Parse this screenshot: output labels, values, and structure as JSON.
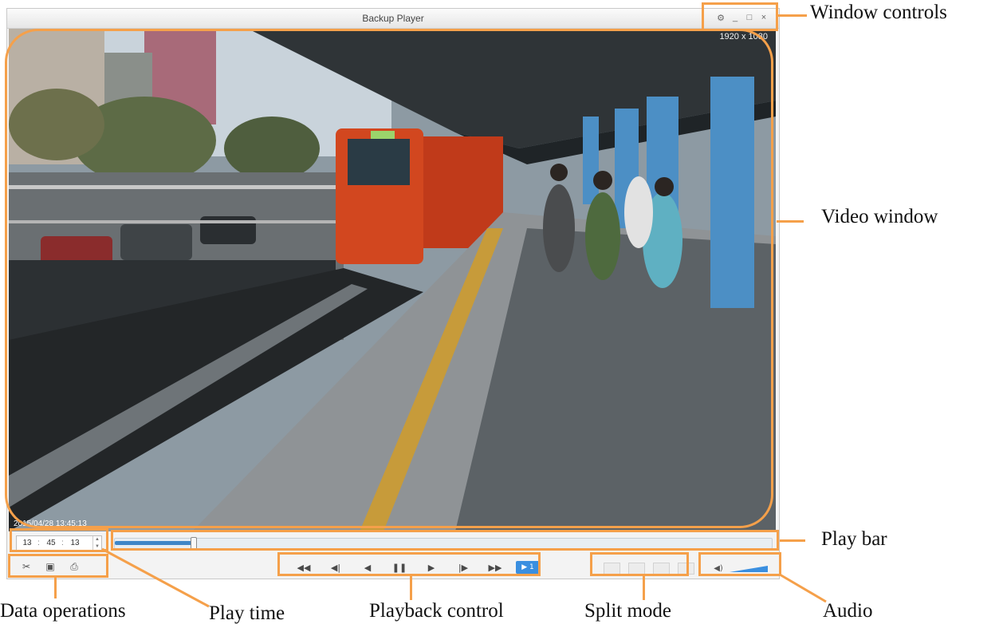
{
  "window": {
    "title": "Backup Player",
    "controls": [
      "⚙",
      "_",
      "□",
      "×"
    ]
  },
  "video": {
    "resolution": "1920 x 1080",
    "osd_timestamp": "2015/04/28 13:45:13"
  },
  "play_time": {
    "hh": "13",
    "mm": "45",
    "ss": "13",
    "sep": ":"
  },
  "play_bar": {
    "progress_percent": 12
  },
  "icons": {
    "data_operations": [
      "clip-icon",
      "snapshot-icon",
      "print-icon"
    ],
    "playback": [
      "fast-backward-icon",
      "step-backward-icon",
      "reverse-play-icon",
      "pause-icon",
      "play-icon",
      "step-forward-icon",
      "fast-forward-icon",
      "speed-icon"
    ],
    "split_modes": [
      "split-1-icon",
      "split-4-icon",
      "split-9-icon",
      "split-16-icon"
    ],
    "audio": [
      "speaker-icon"
    ]
  },
  "glyphs": {
    "data_operations": [
      "✂",
      "▣",
      "⎙"
    ],
    "playback": [
      "◀◀",
      "◀|",
      "◀",
      "❚❚",
      "▶",
      "|▶",
      "▶▶",
      "▶ 1"
    ],
    "audio": "◀)"
  },
  "audio": {
    "volume_percent": 80
  },
  "annotations": {
    "window_controls": "Window controls",
    "video_window": "Video window",
    "play_bar": "Play bar",
    "data_operations": "Data operations",
    "play_time": "Play time",
    "playback_control": "Playback control",
    "split_mode": "Split mode",
    "audio": "Audio"
  },
  "colors": {
    "annotation": "#f5a04a",
    "accent": "#3a8fe0"
  }
}
